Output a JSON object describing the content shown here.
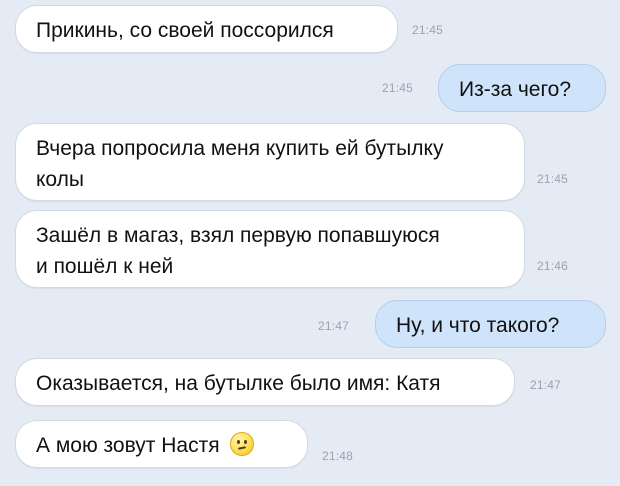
{
  "messages": [
    {
      "text": "Прикинь, со своей поссорился",
      "time": "21:45",
      "direction": "incoming"
    },
    {
      "text": "Из-за чего?",
      "time": "21:45",
      "direction": "outgoing"
    },
    {
      "line1": "Вчера попросила меня купить ей бутылку",
      "line2": "колы",
      "time": "21:45",
      "direction": "incoming"
    },
    {
      "line1": "Зашёл в магаз, взял первую попавшуюся",
      "line2": "и пошёл к ней",
      "time": "21:46",
      "direction": "incoming"
    },
    {
      "text": "Ну, и что такого?",
      "time": "21:47",
      "direction": "outgoing"
    },
    {
      "text": "Оказывается, на бутылке было имя: Катя",
      "time": "21:47",
      "direction": "incoming"
    },
    {
      "text": "А мою зовут Настя",
      "time": "21:48",
      "direction": "incoming",
      "emoji": "confused-face-icon"
    }
  ],
  "colors": {
    "background": "#e4ebf5",
    "incoming_bubble": "#ffffff",
    "outgoing_bubble": "#cfe3fa",
    "timestamp": "#9aa3ae"
  }
}
